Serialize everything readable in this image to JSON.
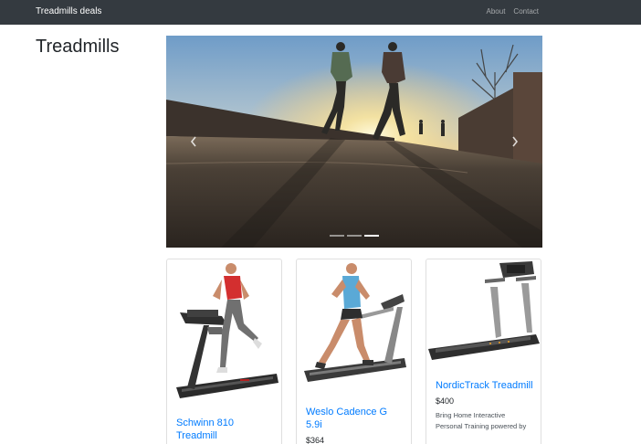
{
  "navbar": {
    "brand": "Treadmills deals",
    "links": [
      "About",
      "Contact"
    ]
  },
  "page": {
    "title": "Treadmills"
  },
  "carousel": {
    "slide_count": 3,
    "active_index": 2
  },
  "products": [
    {
      "name": "Schwinn 810 Treadmill",
      "price": "",
      "description": ""
    },
    {
      "name": "Weslo Cadence G 5.9i",
      "price": "$364",
      "description": ""
    },
    {
      "name": "NordicTrack Treadmill",
      "price": "$400",
      "description": "Bring Home Interactive Personal Training powered by"
    }
  ],
  "colors": {
    "navbar_bg": "#343a40",
    "link": "#007bff"
  }
}
